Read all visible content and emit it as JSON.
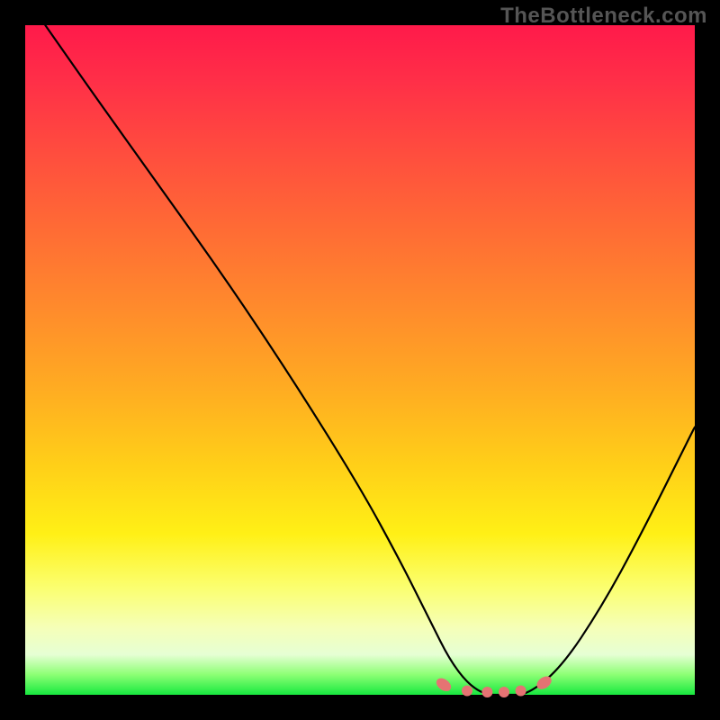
{
  "watermark": "TheBottleneck.com",
  "colors": {
    "frame_bg": "#000000",
    "watermark": "#555555",
    "curve": "#000000",
    "marker_fill": "#e57373",
    "marker_stroke": "#b94a4a",
    "gradient_top": "#ff1a4a",
    "gradient_bottom": "#17e83f"
  },
  "chart_data": {
    "type": "line",
    "title": "",
    "xlabel": "",
    "ylabel": "",
    "xlim": [
      0,
      100
    ],
    "ylim": [
      0,
      100
    ],
    "grid": false,
    "legend": false,
    "series": [
      {
        "name": "bottleneck-curve",
        "x": [
          3,
          10,
          20,
          30,
          40,
          50,
          56,
          60,
          64,
          68,
          72,
          75,
          80,
          86,
          92,
          100
        ],
        "y": [
          100,
          90,
          76,
          62,
          47,
          31,
          20,
          12,
          4,
          0,
          0,
          0,
          4,
          13,
          24,
          40
        ]
      }
    ],
    "markers": {
      "name": "valley-dots",
      "x": [
        62.5,
        66,
        69,
        71.5,
        74,
        77.5
      ],
      "y": [
        1.5,
        0.6,
        0.4,
        0.4,
        0.6,
        1.8
      ]
    }
  }
}
